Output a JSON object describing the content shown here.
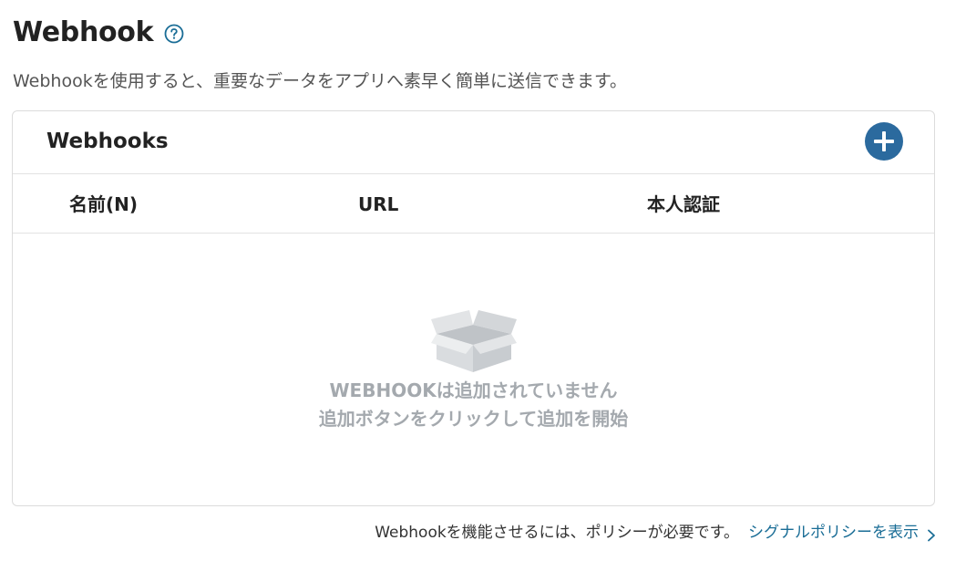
{
  "page": {
    "title": "Webhook",
    "description": "Webhookを使用すると、重要なデータをアプリへ素早く簡単に送信できます。",
    "icons": {
      "help": "help-circle-icon"
    }
  },
  "card": {
    "title": "Webhooks",
    "add_button_icon": "plus-icon",
    "columns": [
      "名前(N)",
      "URL",
      "本人認証"
    ],
    "empty_state": {
      "icon": "empty-box-icon",
      "line1": "WEBHOOKは追加されていません",
      "line2": "追加ボタンをクリックして追加を開始"
    }
  },
  "footer": {
    "text": "Webhookを機能させるには、ポリシーが必要です。",
    "link_label": "シグナルポリシーを表示",
    "link_icon": "chevron-right-icon"
  },
  "colors": {
    "accent": "#2b6a9e",
    "link": "#1a6d96",
    "empty_text": "#a4a9ae"
  }
}
